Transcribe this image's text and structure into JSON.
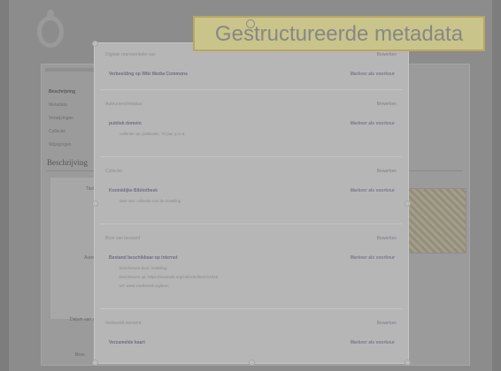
{
  "slide": {
    "title": "Gestructureerde metadata"
  },
  "background_page": {
    "nav_items": [
      "Beschrijving",
      "Metadata",
      "Verwijzingen",
      "Collectie",
      "Wijzigingen"
    ],
    "heading": "Beschrijving",
    "label_1": "Titel",
    "label_2": "Auteur",
    "note": "Datum van creatie",
    "footer": "Bron"
  },
  "metadata_panel": {
    "sections": [
      {
        "title": "Digitale representatie van",
        "action": "Bewerken",
        "properties": [
          {
            "name": "Verbeelding op Wiki Media Commons",
            "action": "Markeer als voorkeur",
            "details": []
          }
        ]
      },
      {
        "title": "Auteursrechtstatus",
        "action": "Bewerken",
        "properties": [
          {
            "name": "publiek domein",
            "action": "Markeer als voorkeur",
            "details": [
              "vallende op: publicatie, 70 jaar p.m.a."
            ]
          }
        ]
      },
      {
        "title": "Collectie",
        "action": "Bewerken",
        "properties": [
          {
            "name": "Koninklijke Bibliotheek",
            "action": "Markeer als voorkeur",
            "details": [
              "deel van: collectie van de instelling"
            ]
          }
        ]
      },
      {
        "title": "Bron van bestand",
        "action": "Bewerken",
        "properties": [
          {
            "name": "Bestand beschikbaar op internet",
            "action": "Markeer als voorkeur",
            "details": [
              "beschreven door: instelling",
              "beschreven op: https://example.org/collectie/item/12345",
              "url: www.voorbeeld.org/item"
            ]
          }
        ]
      },
      {
        "title": "Verbeeldt element",
        "action": "Bewerken",
        "properties": [
          {
            "name": "Verzamelde kaart",
            "action": "Markeer als voorkeur",
            "details": []
          }
        ]
      }
    ]
  }
}
